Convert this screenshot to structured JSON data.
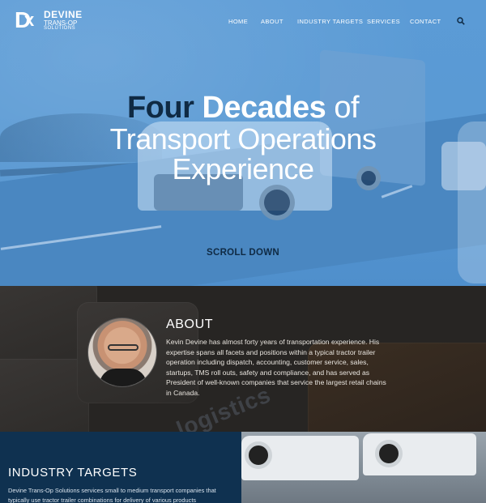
{
  "nav": {
    "brand_name": "DEVINE",
    "brand_sub1": "TRANS-OP",
    "brand_sub2": "SOLUTIONS",
    "items": [
      {
        "label": "HOME"
      },
      {
        "label": "ABOUT"
      },
      {
        "label": "INDUSTRY TARGETS"
      },
      {
        "label": "SERVICES"
      },
      {
        "label": "CONTACT"
      }
    ],
    "search_icon": "search-icon"
  },
  "hero": {
    "title_bold1": "Four",
    "title_bold2": "Decades",
    "title_light1": "of",
    "title_line2": "Transport Operations",
    "title_line3": "Experience",
    "scroll_label": "SCROLL DOWN",
    "overlay_color": "#5b9bd6"
  },
  "about": {
    "heading": "ABOUT",
    "body": "Kevin Devine has almost forty years of transportation experience. His expertise spans all facets and positions within a typical tractor trailer operation including dispatch, accounting, customer service, sales, startups, TMS roll outs, safety and compliance, and has served as President of well-known companies that service the largest retail chains in Canada.",
    "background_word": "logistics"
  },
  "industry": {
    "heading": "INDUSTRY TARGETS",
    "body": "Devine Trans-Op Solutions services small to medium transport companies that typically use tractor trailer combinations for delivery of various products"
  },
  "colors": {
    "navy": "#0f2a44",
    "industry_bg": "#0f3150",
    "about_bg": "#272523"
  }
}
